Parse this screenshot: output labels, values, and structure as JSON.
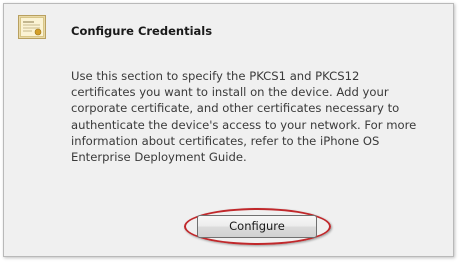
{
  "section": {
    "title": "Configure Credentials",
    "icon": "certificate-icon",
    "description_lines": [
      "Use this section to specify the PKCS1 and PKCS12",
      "certificates you want to install on the device. Add your",
      "corporate certificate, and other certificates necessary to",
      "authenticate the device's access to your network. For more",
      "information about certificates, refer to the iPhone OS",
      "Enterprise Deployment Guide."
    ],
    "button_label": "Configure"
  },
  "colors": {
    "panel_background": "#f0f0f0",
    "panel_border": "#b9b9b9",
    "highlight": "#c0282b"
  }
}
